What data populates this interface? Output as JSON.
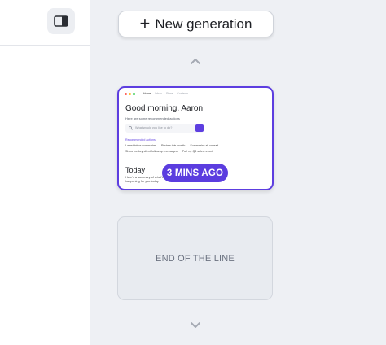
{
  "sidebar": {
    "toggle_icon": "sidebar-panel-icon"
  },
  "main": {
    "new_generation_label": "New generation",
    "new_generation_icon": "plus-icon",
    "time_badge": "3 MINS AGO",
    "end_label": "END OF THE LINE"
  },
  "thumbnail": {
    "nav": [
      "Home",
      "Inbox",
      "Store",
      "Contacts"
    ],
    "greeting": "Good morning, Aaron",
    "subtitle": "Here are some recommended actions",
    "input_placeholder": "What would you like to do?",
    "recommended_label": "Recommended actions",
    "actions_row1": [
      "Latest inbox summaries",
      "Review this month",
      "Summarize all unread"
    ],
    "actions_row2": [
      "Show me key client follow-up messages",
      "Pull my Q3 sales report"
    ],
    "today_title": "Today",
    "today_text": "Here's a summary of what's happening for you today"
  },
  "colors": {
    "accent": "#5b3ddf",
    "background": "#eef0f4",
    "sidebar": "#ffffff"
  }
}
